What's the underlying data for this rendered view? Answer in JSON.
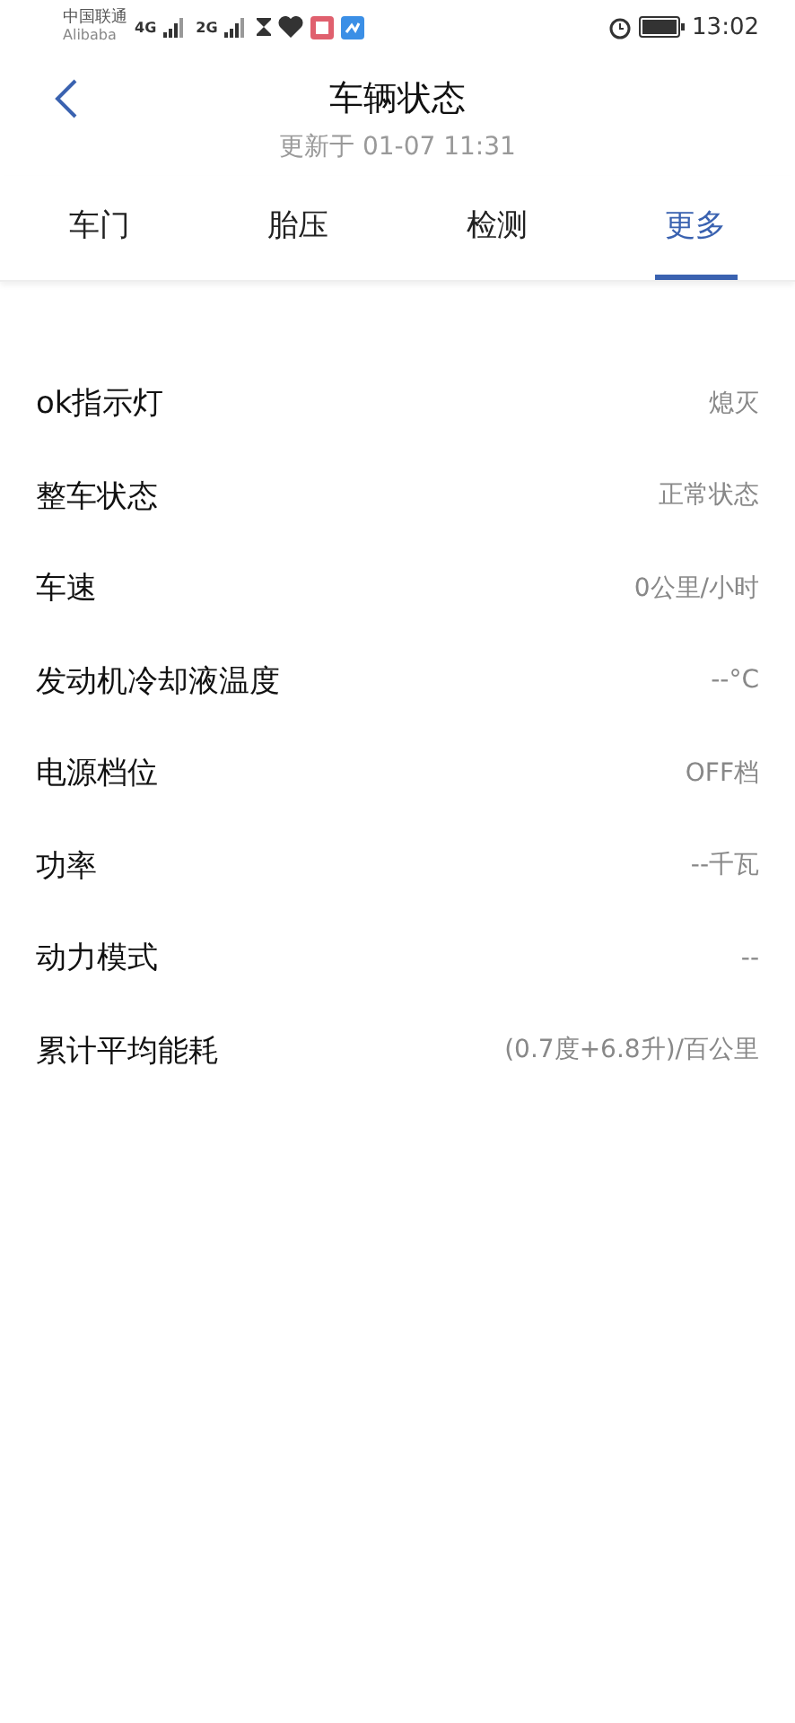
{
  "status_bar": {
    "carrier": "中国联通",
    "carrier_sub": "Alibaba",
    "network_1": "4G",
    "network_2": "2G",
    "time": "13:02"
  },
  "header": {
    "title": "车辆状态",
    "subtitle": "更新于 01-07 11:31"
  },
  "tabs": [
    {
      "label": "车门",
      "selected": false
    },
    {
      "label": "胎压",
      "selected": false
    },
    {
      "label": "检测",
      "selected": false
    },
    {
      "label": "更多",
      "selected": true
    }
  ],
  "rows": [
    {
      "label": "ok指示灯",
      "value": "熄灭"
    },
    {
      "label": "整车状态",
      "value": "正常状态"
    },
    {
      "label": "车速",
      "value": "0公里/小时"
    },
    {
      "label": "发动机冷却液温度",
      "value": "--°C"
    },
    {
      "label": "电源档位",
      "value": "OFF档"
    },
    {
      "label": "功率",
      "value": "--千瓦"
    },
    {
      "label": "动力模式",
      "value": "--"
    },
    {
      "label": "累计平均能耗",
      "value": "(0.7度+6.8升)/百公里"
    }
  ]
}
